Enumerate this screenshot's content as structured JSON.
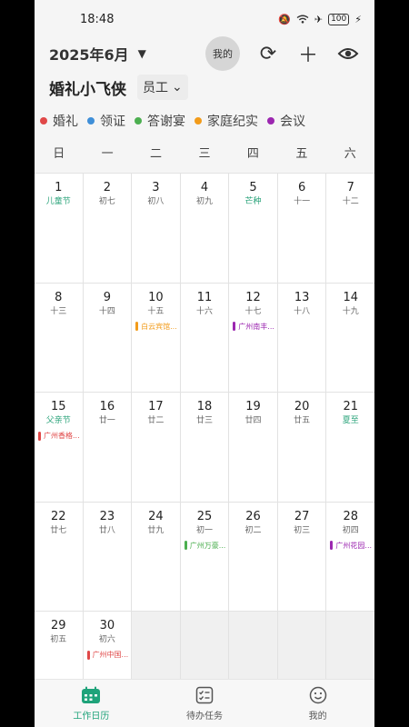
{
  "status": {
    "time": "18:48",
    "battery": "100"
  },
  "header": {
    "month": "2025年6月",
    "me_label": "我的"
  },
  "title": {
    "team": "婚礼小飞侠",
    "role": "员工"
  },
  "legend": [
    {
      "label": "婚礼",
      "color": "#e04848"
    },
    {
      "label": "领证",
      "color": "#3f8fd8"
    },
    {
      "label": "答谢宴",
      "color": "#4caf50"
    },
    {
      "label": "家庭纪实",
      "color": "#f29b1a"
    },
    {
      "label": "会议",
      "color": "#9c27b0"
    }
  ],
  "weekdays": [
    "日",
    "一",
    "二",
    "三",
    "四",
    "五",
    "六"
  ],
  "calendar": {
    "cells": [
      {
        "day": "1",
        "lunar": "儿童节",
        "festival": true
      },
      {
        "day": "2",
        "lunar": "初七"
      },
      {
        "day": "3",
        "lunar": "初八"
      },
      {
        "day": "4",
        "lunar": "初九"
      },
      {
        "day": "5",
        "lunar": "芒种",
        "festival": true
      },
      {
        "day": "6",
        "lunar": "十一"
      },
      {
        "day": "7",
        "lunar": "十二"
      },
      {
        "day": "8",
        "lunar": "十三"
      },
      {
        "day": "9",
        "lunar": "十四"
      },
      {
        "day": "10",
        "lunar": "十五",
        "event": {
          "label": "白云宾馆...",
          "color": "#f29b1a"
        }
      },
      {
        "day": "11",
        "lunar": "十六"
      },
      {
        "day": "12",
        "lunar": "十七",
        "event": {
          "label": "广州南丰...",
          "color": "#9c27b0"
        }
      },
      {
        "day": "13",
        "lunar": "十八"
      },
      {
        "day": "14",
        "lunar": "十九"
      },
      {
        "day": "15",
        "lunar": "父亲节",
        "festival": true,
        "event": {
          "label": "广州香格...",
          "color": "#e04848"
        }
      },
      {
        "day": "16",
        "lunar": "廿一"
      },
      {
        "day": "17",
        "lunar": "廿二"
      },
      {
        "day": "18",
        "lunar": "廿三"
      },
      {
        "day": "19",
        "lunar": "廿四"
      },
      {
        "day": "20",
        "lunar": "廿五"
      },
      {
        "day": "21",
        "lunar": "夏至",
        "festival": true
      },
      {
        "day": "22",
        "lunar": "廿七"
      },
      {
        "day": "23",
        "lunar": "廿八"
      },
      {
        "day": "24",
        "lunar": "廿九"
      },
      {
        "day": "25",
        "lunar": "初一",
        "event": {
          "label": "广州万豪...",
          "color": "#4caf50"
        }
      },
      {
        "day": "26",
        "lunar": "初二"
      },
      {
        "day": "27",
        "lunar": "初三"
      },
      {
        "day": "28",
        "lunar": "初四",
        "event": {
          "label": "广州花园...",
          "color": "#9c27b0"
        }
      },
      {
        "day": "29",
        "lunar": "初五"
      },
      {
        "day": "30",
        "lunar": "初六",
        "event": {
          "label": "广州中国...",
          "color": "#e04848"
        }
      },
      {
        "empty": true
      },
      {
        "empty": true
      },
      {
        "empty": true
      },
      {
        "empty": true
      },
      {
        "empty": true
      }
    ]
  },
  "tabbar": {
    "tabs": [
      {
        "label": "工作日历",
        "active": true
      },
      {
        "label": "待办任务",
        "active": false
      },
      {
        "label": "我的",
        "active": false
      }
    ]
  }
}
